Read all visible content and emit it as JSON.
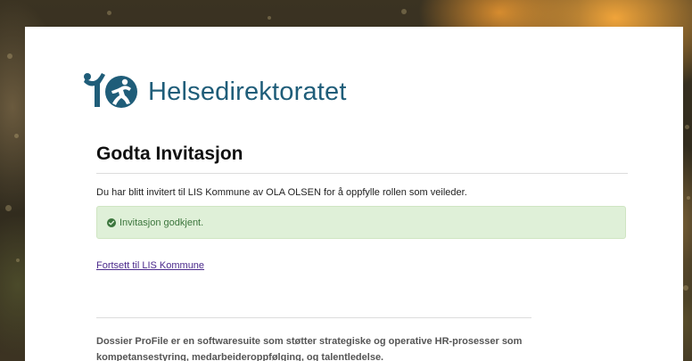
{
  "brand": {
    "name": "Helsedirektoratet",
    "logo_icon": "helsedirektoratet-logo-icon",
    "color": "#1f5d79"
  },
  "page": {
    "title": "Godta Invitasjon",
    "intro": "Du har blitt invitert til LIS Kommune av OLA OLSEN for å oppfylle rollen som veileder."
  },
  "alert": {
    "icon": "check-circle-icon",
    "text": "Invitasjon godkjent.",
    "background": "#dff0d8",
    "color": "#3c763d"
  },
  "link": {
    "text": "Fortsett til LIS Kommune",
    "color": "#4b2a8c"
  },
  "footer": {
    "text": "Dossier ProFile er en softwaresuite som støtter strategiske og operative HR-prosesser som kompetansestyring, medarbeideroppfølging, og talentledelse."
  }
}
